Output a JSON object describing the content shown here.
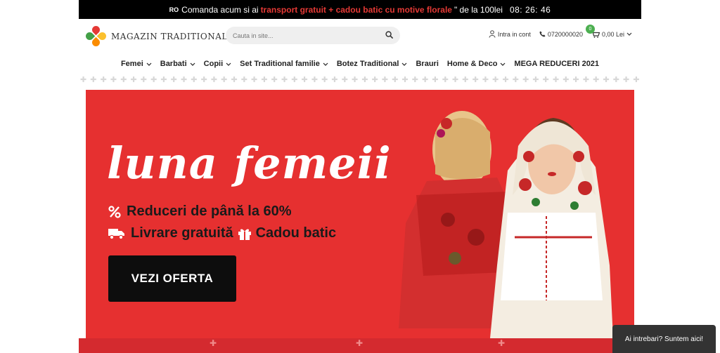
{
  "topbar": {
    "lang": "RO",
    "text_before": "Comanda acum si ai",
    "highlight": "transport gratuit + cadou batic cu motive florale",
    "text_after": "\" de la 100lei",
    "timer": "08: 26: 46"
  },
  "header": {
    "logo_text": "MAGAZIN TRADITIONAL",
    "search_placeholder": "Cauta in site...",
    "login_label": "Intra in cont",
    "phone": "0720000020",
    "cart_count": "0",
    "cart_total": "0,00 Lei"
  },
  "nav": {
    "items": [
      {
        "label": "Femei",
        "has_dropdown": true
      },
      {
        "label": "Barbati",
        "has_dropdown": true
      },
      {
        "label": "Copii",
        "has_dropdown": true
      },
      {
        "label": "Set Traditional familie",
        "has_dropdown": true
      },
      {
        "label": "Botez Traditional",
        "has_dropdown": true
      },
      {
        "label": "Brauri",
        "has_dropdown": false
      },
      {
        "label": "Home & Deco",
        "has_dropdown": true
      },
      {
        "label": "MEGA REDUCERI 2021",
        "has_dropdown": false
      }
    ]
  },
  "hero": {
    "title": "luna femeii",
    "line1": "Reduceri de până la 60%",
    "line2a": "Livrare gratuită",
    "line2b": "Cadou batic",
    "cta": "VEZI OFERTA"
  },
  "chat": {
    "label": "Ai intrebari? Suntem aici!"
  },
  "colors": {
    "topbar_bg": "#000000",
    "highlight": "#e53935",
    "hero_bg": "#e63030",
    "cart_badge": "#4caf50",
    "chat_bg": "#333333"
  }
}
